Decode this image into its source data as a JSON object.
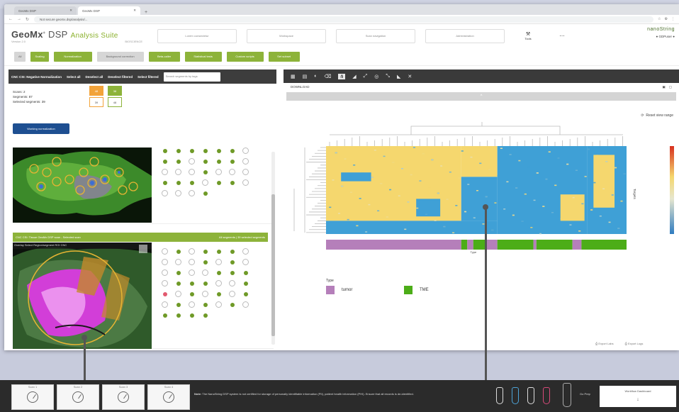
{
  "browser": {
    "tabs": [
      "GeoMx DSP",
      "GeoMx DSP"
    ],
    "url": "Not secure  geomx.dsp/analysis/..."
  },
  "header": {
    "logo_name": "GeoMx",
    "logo_product": "DSP",
    "logo_suite": "Analysis Suite",
    "logo_subtitle_left": "Version 2.0",
    "logo_subtitle_right": "BIOSCIENCE",
    "brand": "nanoString",
    "menu_boxes": [
      "Lorem consectetur",
      "Workspace",
      "Scan navigation",
      "Administration"
    ],
    "tool_label": "Tools",
    "user_label": "GDPuser"
  },
  "workflow": {
    "buttons": [
      "All",
      "Scaling",
      "Normalization",
      "Background correction",
      "Beta-caller",
      "Statistical tests",
      "Custom scripts",
      "Set subset"
    ]
  },
  "left_panel": {
    "toolbar_labels": [
      "CNC CSI: Negative Normalization",
      "Select all",
      "Deselect all",
      "Deselect filtered",
      "Select filtered"
    ],
    "search_placeholder": "Search segments by tags",
    "info": {
      "scans": "Scans: 2",
      "segments": "Segments: 87",
      "selected": "Selected segments: 39"
    },
    "chips": [
      "48",
      "38",
      "39",
      "48"
    ],
    "blue_button": "Working normalization",
    "card2_title": "CNC CSI: Tissue GeoMx DSP scan - Selected scan",
    "card2_right": "All segments   |   39 selected segments",
    "card2_sub": "Overlay   Select   Region/segment ROI   CNC"
  },
  "right_panel": {
    "toolbar_icons": [
      "table-icon",
      "grid-icon",
      "contrast-icon",
      "trash-icon",
      "cluster-icon",
      "bar-icon",
      "line-icon",
      "target-icon",
      "scatter-icon",
      "volcano-icon",
      "close-x-icon"
    ],
    "subtitle": "DOWNLOAD",
    "collapse": "^",
    "reset_label": "Reset view range",
    "legend_title": "Type",
    "legend_items": [
      {
        "label": "tumor",
        "color": "#b57fba"
      },
      {
        "label": "TME",
        "color": "#4cad18"
      }
    ],
    "export_labels": [
      "Export Labs",
      "Export Logs"
    ],
    "heatmap_colors": {
      "high": "#f5d76e",
      "low": "#3fa0d6",
      "mid": "#e6e6cf"
    },
    "axis_label": "Targets",
    "col_label": "Type"
  },
  "taskbar": {
    "cards": [
      "Scan 1",
      "Scan 2",
      "Scan 3",
      "Scan 4"
    ],
    "note_label": "Note:",
    "note": "The NanoString DSP system is not certified for storage of personally identifiable information (PII), patient health information (PHI). Ensure that all records is de-identified.",
    "tube_colors": [
      "#dddddd",
      "#4da3d8",
      "#dddddd",
      "#d94a7a"
    ],
    "right_label": "Go Prep",
    "white_box_title": "Workflow Dashboard",
    "white_box_arrow": "↓"
  }
}
